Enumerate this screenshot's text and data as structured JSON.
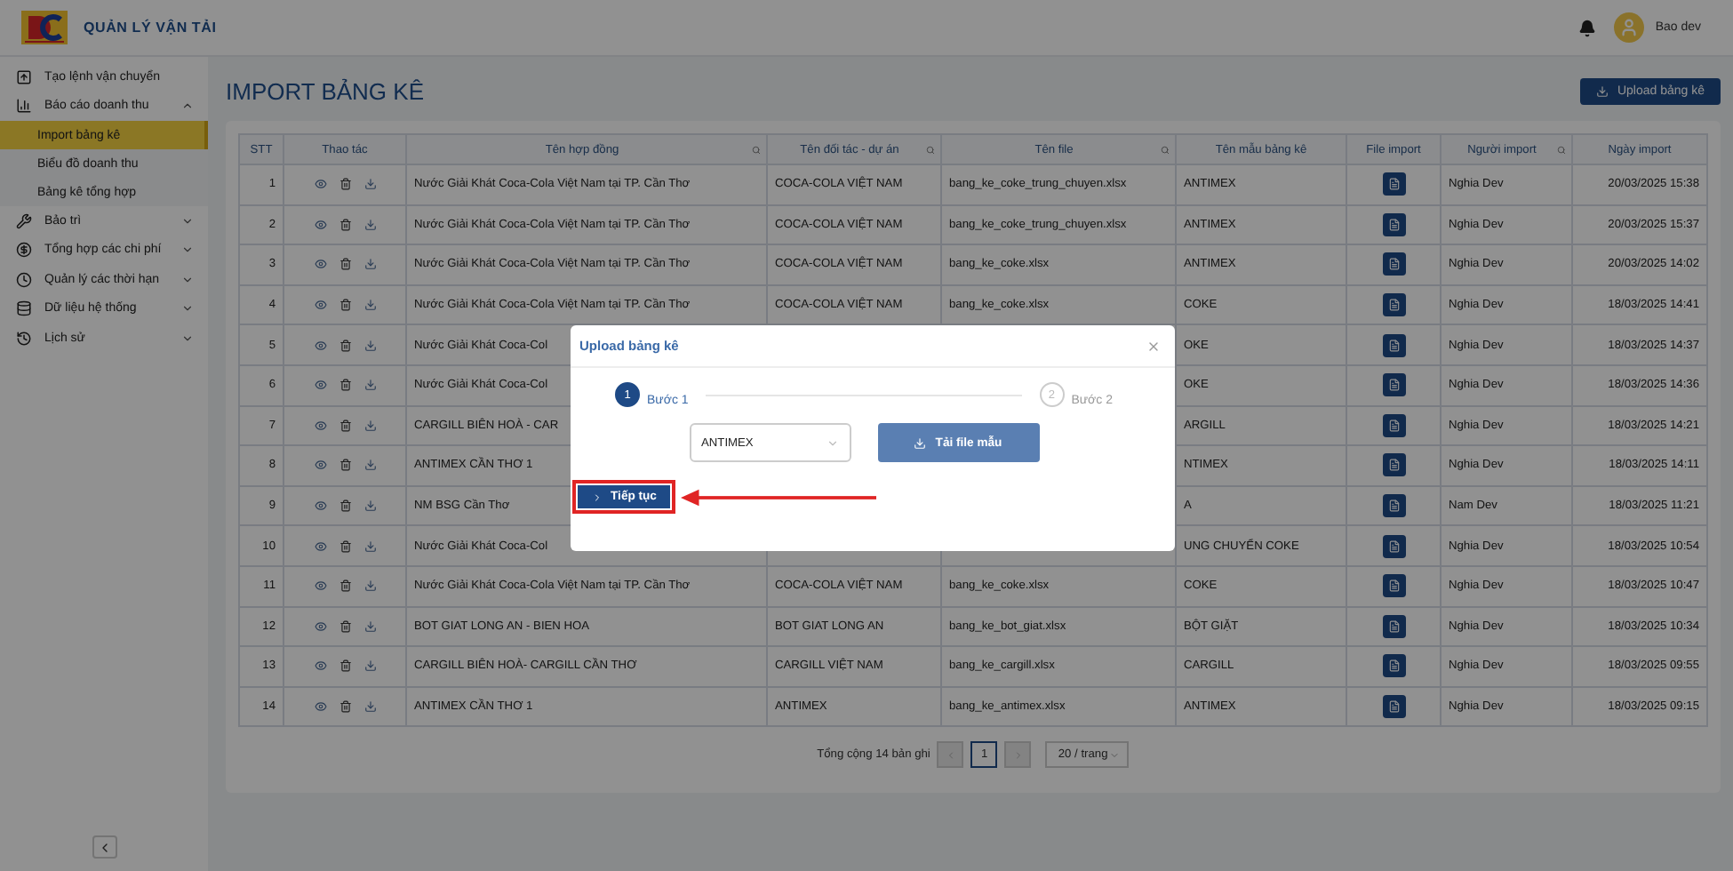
{
  "header": {
    "app_title": "QUẢN LÝ VẬN TẢI",
    "user_name": "Bao dev"
  },
  "sidebar": {
    "items": [
      {
        "label": "Tạo lệnh vận chuyển"
      },
      {
        "label": "Báo cáo doanh thu",
        "expanded": true,
        "children": [
          {
            "label": "Import bảng kê",
            "selected": true
          },
          {
            "label": "Biểu đồ doanh thu",
            "selected": false
          },
          {
            "label": "Bảng kê tổng hợp",
            "selected": false
          }
        ]
      },
      {
        "label": "Bảo trì",
        "expanded": false
      },
      {
        "label": "Tổng hợp các chi phí",
        "expanded": false
      },
      {
        "label": "Quản lý các thời hạn",
        "expanded": false
      },
      {
        "label": "Dữ liệu hệ thống",
        "expanded": false
      },
      {
        "label": "Lịch sử",
        "expanded": false
      }
    ]
  },
  "page": {
    "title": "IMPORT BẢNG KÊ",
    "upload_button": "Upload bảng kê"
  },
  "table": {
    "columns": [
      {
        "label": "STT",
        "searchable": false
      },
      {
        "label": "Thao tác",
        "searchable": false
      },
      {
        "label": "Tên hợp đồng",
        "searchable": true
      },
      {
        "label": "Tên đối tác - dự án",
        "searchable": true
      },
      {
        "label": "Tên file",
        "searchable": true
      },
      {
        "label": "Tên mẫu bảng kê",
        "searchable": false
      },
      {
        "label": "File import",
        "searchable": false
      },
      {
        "label": "Người import",
        "searchable": true
      },
      {
        "label": "Ngày import",
        "searchable": false
      }
    ],
    "rows": [
      {
        "stt": "1",
        "contract": "Nước Giải Khát Coca-Cola Việt Nam tại TP. Cần Thơ",
        "partner": "COCA-COLA VIỆT NAM",
        "file": "bang_ke_coke_trung_chuyen.xlsx",
        "template": "ANTIMEX",
        "importer": "Nghia Dev",
        "date": "20/03/2025 15:38"
      },
      {
        "stt": "2",
        "contract": "Nước Giải Khát Coca-Cola Việt Nam tại TP. Cần Thơ",
        "partner": "COCA-COLA VIỆT NAM",
        "file": "bang_ke_coke_trung_chuyen.xlsx",
        "template": "ANTIMEX",
        "importer": "Nghia Dev",
        "date": "20/03/2025 15:37"
      },
      {
        "stt": "3",
        "contract": "Nước Giải Khát Coca-Cola Việt Nam tại TP. Cần Thơ",
        "partner": "COCA-COLA VIỆT NAM",
        "file": "bang_ke_coke.xlsx",
        "template": "ANTIMEX",
        "importer": "Nghia Dev",
        "date": "20/03/2025 14:02"
      },
      {
        "stt": "4",
        "contract": "Nước Giải Khát Coca-Cola Việt Nam tại TP. Cần Thơ",
        "partner": "COCA-COLA VIỆT NAM",
        "file": "bang_ke_coke.xlsx",
        "template": "COKE",
        "importer": "Nghia Dev",
        "date": "18/03/2025 14:41"
      },
      {
        "stt": "5",
        "contract": "Nước Giải Khát Coca-Col",
        "template": "OKE",
        "importer": "Nghia Dev",
        "date": "18/03/2025 14:37"
      },
      {
        "stt": "6",
        "contract": "Nước Giải Khát Coca-Col",
        "template": "OKE",
        "importer": "Nghia Dev",
        "date": "18/03/2025 14:36"
      },
      {
        "stt": "7",
        "contract": "CARGILL BIÊN HOÀ - CAR",
        "template": "ARGILL",
        "importer": "Nghia Dev",
        "date": "18/03/2025 14:21"
      },
      {
        "stt": "8",
        "contract": "ANTIMEX CẦN THƠ 1",
        "template": "NTIMEX",
        "importer": "Nghia Dev",
        "date": "18/03/2025 14:11"
      },
      {
        "stt": "9",
        "contract": "NM BSG Cần Thơ",
        "template": "A",
        "importer": "Nam Dev",
        "date": "18/03/2025 11:21"
      },
      {
        "stt": "10",
        "contract": "Nước Giải Khát Coca-Col",
        "template": "UNG CHUYỂN COKE",
        "importer": "Nghia Dev",
        "date": "18/03/2025 10:54"
      },
      {
        "stt": "11",
        "contract": "Nước Giải Khát Coca-Cola Việt Nam tại TP. Cần Thơ",
        "partner": "COCA-COLA VIỆT NAM",
        "file": "bang_ke_coke.xlsx",
        "template": "COKE",
        "importer": "Nghia Dev",
        "date": "18/03/2025 10:47"
      },
      {
        "stt": "12",
        "contract": "BOT GIAT LONG AN - BIEN HOA",
        "partner": "BOT GIAT LONG AN",
        "file": "bang_ke_bot_giat.xlsx",
        "template": "BỘT GIẶT",
        "importer": "Nghia Dev",
        "date": "18/03/2025 10:34"
      },
      {
        "stt": "13",
        "contract": "CARGILL BIÊN HOÀ- CARGILL CẦN THƠ",
        "partner": "CARGILL VIỆT NAM",
        "file": "bang_ke_cargill.xlsx",
        "template": "CARGILL",
        "importer": "Nghia Dev",
        "date": "18/03/2025 09:55"
      },
      {
        "stt": "14",
        "contract": "ANTIMEX CẦN THƠ 1",
        "partner": "ANTIMEX",
        "file": "bang_ke_antimex.xlsx",
        "template": "ANTIMEX",
        "importer": "Nghia Dev",
        "date": "18/03/2025 09:15"
      }
    ]
  },
  "pagination": {
    "total": "Tổng cộng 14 bản ghi",
    "pages": [
      {
        "label": "1",
        "selected": true
      }
    ],
    "page_size": "20 / trang"
  },
  "modal": {
    "title": "Upload bảng kê",
    "steps": [
      {
        "number": "1",
        "label": "Bước 1",
        "selected": true
      },
      {
        "number": "2",
        "label": "Bước 2",
        "selected": false
      }
    ],
    "template_select": "ANTIMEX",
    "download_button": "Tải file mẫu",
    "next_button": "Tiếp tục"
  }
}
